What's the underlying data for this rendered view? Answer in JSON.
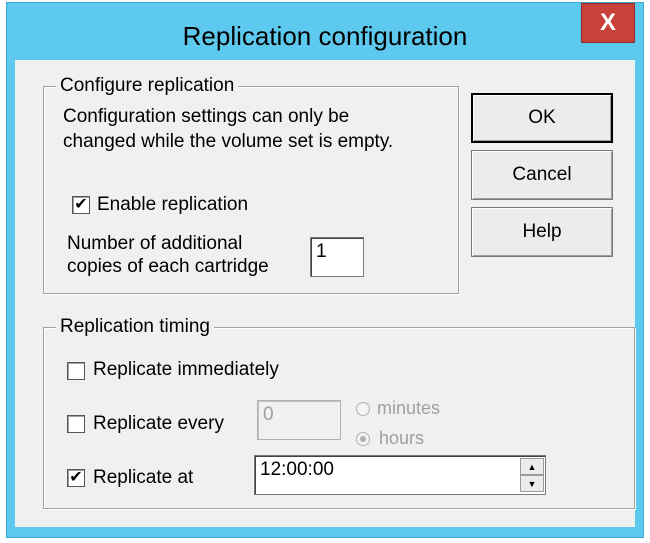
{
  "window": {
    "title": "Replication configuration",
    "close_label": "X"
  },
  "configure": {
    "group_label": "Configure replication",
    "note_line1": "Configuration settings can only be",
    "note_line2": "changed while the volume set is empty.",
    "enable_checked": "✔",
    "enable_label": "Enable replication",
    "copies_label_line1": "Number of additional",
    "copies_label_line2": "copies of each cartridge",
    "copies_value": "1"
  },
  "buttons": {
    "ok": "OK",
    "cancel": "Cancel",
    "help": "Help"
  },
  "timing": {
    "group_label": "Replication timing",
    "immediately_label": "Replicate immediately",
    "every_label": "Replicate every",
    "every_value": "0",
    "minutes_label": "minutes",
    "hours_label": "hours",
    "at_checked": "✔",
    "at_label": "Replicate at",
    "at_value": "12:00:00"
  },
  "colors": {
    "titlebar": "#5ec9ee",
    "close": "#c8413a",
    "face": "#f0f0f0"
  }
}
